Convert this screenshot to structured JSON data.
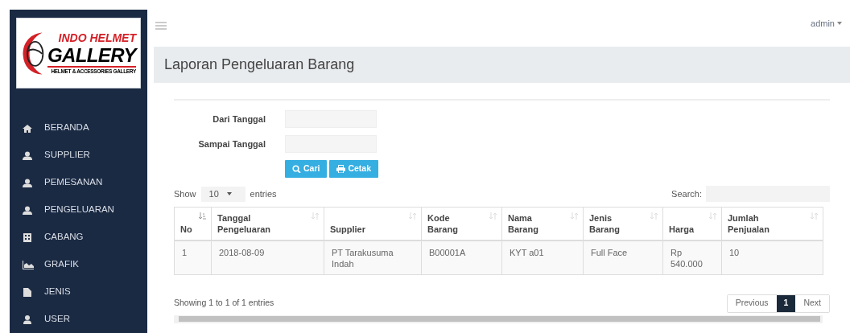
{
  "logo": {
    "line_1": "INDO HELMET",
    "line_2": "GALLERY",
    "line_3": "HELMET & ACCESSORIES GALLERY"
  },
  "sidebar": {
    "items": [
      {
        "label": "BERANDA",
        "kind": "home"
      },
      {
        "label": "SUPPLIER",
        "kind": "user"
      },
      {
        "label": "PEMESANAN",
        "kind": "user"
      },
      {
        "label": "PENGELUARAN",
        "kind": "user"
      },
      {
        "label": "CABANG",
        "kind": "building"
      },
      {
        "label": "GRAFIK",
        "kind": "chart"
      },
      {
        "label": "JENIS",
        "kind": "file"
      },
      {
        "label": "USER",
        "kind": "person"
      }
    ]
  },
  "topbar": {
    "user": "admin"
  },
  "page_title": "Laporan Pengeluaran Barang",
  "filter": {
    "fields": [
      {
        "label": "Dari Tanggal"
      },
      {
        "label": "Sampai Tanggal"
      }
    ],
    "buttons": [
      {
        "label": "Cari",
        "kind": "search"
      },
      {
        "label": "Cetak",
        "kind": "print"
      }
    ]
  },
  "table": {
    "length": {
      "before": "Show",
      "value": "10",
      "after": "entries"
    },
    "search_label": "Search:",
    "columns": [
      {
        "label": "No",
        "sorted": true
      },
      {
        "label": "Tanggal Pengeluaran",
        "sorted": false
      },
      {
        "label": "Supplier",
        "sorted": false
      },
      {
        "label": "Kode Barang",
        "sorted": false
      },
      {
        "label": "Nama Barang",
        "sorted": false
      },
      {
        "label": "Jenis Barang",
        "sorted": false
      },
      {
        "label": "Harga",
        "sorted": false
      },
      {
        "label": "Jumlah Penjualan",
        "sorted": false
      }
    ],
    "rows": [
      [
        "1",
        "2018-08-09",
        "PT Tarakusuma Indah",
        "B00001A",
        "KYT a01",
        "Full Face",
        "Rp 540.000",
        "10"
      ]
    ],
    "info": "Showing 1 to 1 of 1 entries",
    "pagination": [
      {
        "label": "Previous",
        "selected": false
      },
      {
        "label": "1",
        "selected": true
      },
      {
        "label": "Next",
        "selected": false
      }
    ]
  }
}
